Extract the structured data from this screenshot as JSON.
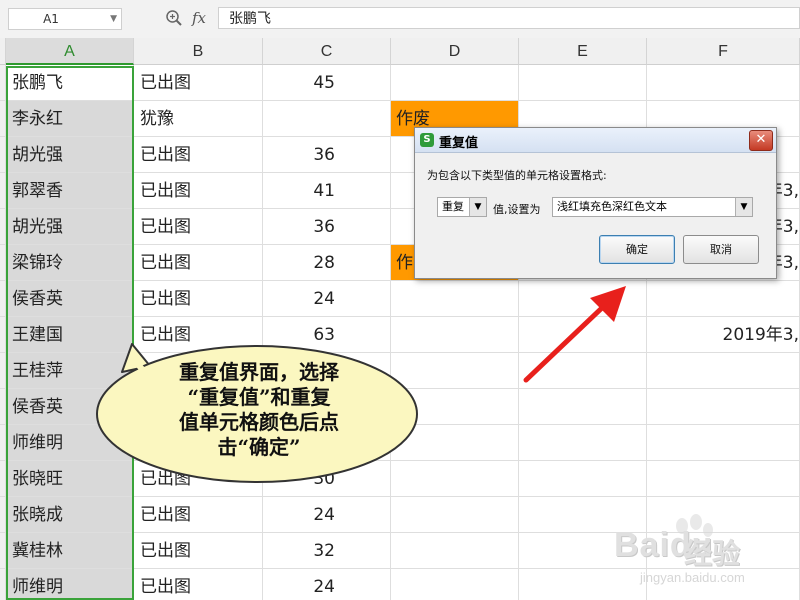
{
  "formula_bar": {
    "name_box": "A1",
    "fx_label": "fx",
    "formula_value": "张鹏飞",
    "zoom_icon": "zoom-icon"
  },
  "columns": [
    "A",
    "B",
    "C",
    "D",
    "E",
    "F"
  ],
  "selected_column": "A",
  "rows": [
    {
      "a": "张鹏飞",
      "b": "已出图",
      "c": "45",
      "d": "",
      "f": ""
    },
    {
      "a": "李永红",
      "b": "犹豫",
      "c": "",
      "d": "作废",
      "f": ""
    },
    {
      "a": "胡光强",
      "b": "已出图",
      "c": "36",
      "d": "",
      "f": ""
    },
    {
      "a": "郭翠香",
      "b": "已出图",
      "c": "41",
      "d": "",
      "f": "年3,"
    },
    {
      "a": "胡光强",
      "b": "已出图",
      "c": "36",
      "d": "",
      "f": "年3,"
    },
    {
      "a": "梁锦玲",
      "b": "已出图",
      "c": "28",
      "d": "作",
      "f": "年3,"
    },
    {
      "a": "侯香英",
      "b": "已出图",
      "c": "24",
      "d": "",
      "f": ""
    },
    {
      "a": "王建国",
      "b": "已出图",
      "c": "63",
      "d": "",
      "f": "2019年3,"
    },
    {
      "a": "王桂萍",
      "b": "",
      "c": "",
      "d": "",
      "f": ""
    },
    {
      "a": "侯香英",
      "b": "",
      "c": "",
      "d": "",
      "f": ""
    },
    {
      "a": "师维明",
      "b": "",
      "c": "",
      "d": "",
      "f": ""
    },
    {
      "a": "张晓旺",
      "b": "已出图",
      "c": "30",
      "d": "",
      "f": ""
    },
    {
      "a": "张晓成",
      "b": "已出图",
      "c": "24",
      "d": "",
      "f": ""
    },
    {
      "a": "冀桂林",
      "b": "已出图",
      "c": "32",
      "d": "",
      "f": ""
    },
    {
      "a": "师维明",
      "b": "已出图",
      "c": "24",
      "d": "",
      "f": ""
    }
  ],
  "highlight_color": "#ff9900",
  "selection_color": "#3aa33a",
  "dialog": {
    "title": "重复值",
    "icon_letter": "S",
    "close_symbol": "✕",
    "prompt": "为包含以下类型值的单元格设置格式:",
    "type_value": "重复",
    "set_label": "值,设置为",
    "style_value": "浅红填充色深红色文本",
    "ok_label": "确定",
    "cancel_label": "取消"
  },
  "callout": {
    "lines": [
      "重复值界面，选择",
      "“重复值”和重复",
      "值单元格颜色后点",
      "击“确定”"
    ]
  },
  "watermark": {
    "brand": "Baidu",
    "brand_cn": "经验",
    "url": "jingyan.baidu.com"
  }
}
